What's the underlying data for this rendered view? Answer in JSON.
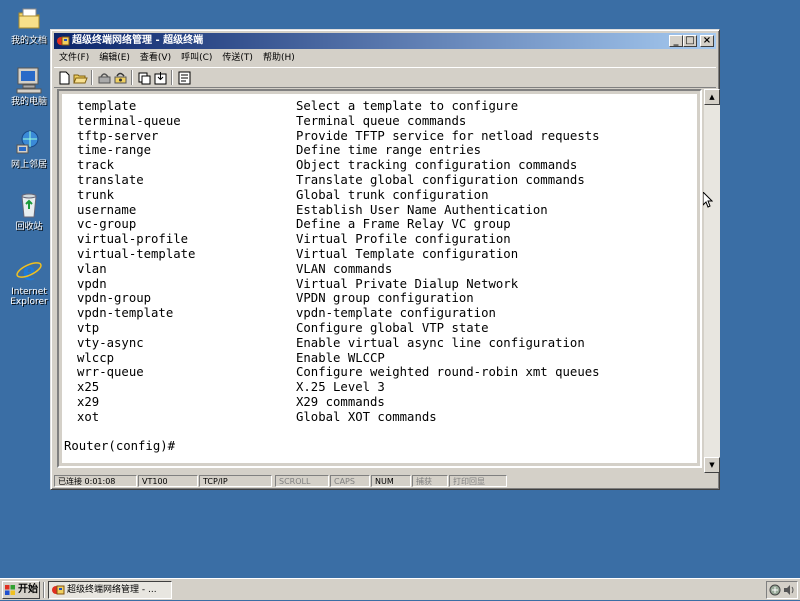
{
  "desktop": {
    "icons": [
      {
        "label": "我的文档",
        "icon": "my-documents-icon"
      },
      {
        "label": "我的电脑",
        "icon": "my-computer-icon"
      },
      {
        "label": "网上邻居",
        "icon": "network-places-icon"
      },
      {
        "label": "回收站",
        "icon": "recycle-bin-icon"
      },
      {
        "label": "Internet Explorer",
        "icon": "internet-explorer-icon"
      }
    ]
  },
  "window": {
    "title": "超级终端网络管理 - 超级终端",
    "controls": {
      "minimize": "_",
      "maximize": "□",
      "close": "×"
    },
    "menu": [
      "文件(F)",
      "编辑(E)",
      "查看(V)",
      "呼叫(C)",
      "传送(T)",
      "帮助(H)"
    ],
    "toolbar": [
      "new-icon",
      "open-icon",
      "connect-icon",
      "disconnect-icon",
      "send-icon",
      "receive-icon",
      "properties-icon"
    ]
  },
  "terminal": {
    "commands": [
      {
        "name": "template",
        "desc": "Select a template to configure"
      },
      {
        "name": "terminal-queue",
        "desc": "Terminal queue commands"
      },
      {
        "name": "tftp-server",
        "desc": "Provide TFTP service for netload requests"
      },
      {
        "name": "time-range",
        "desc": "Define time range entries"
      },
      {
        "name": "track",
        "desc": "Object tracking configuration commands"
      },
      {
        "name": "translate",
        "desc": "Translate global configuration commands"
      },
      {
        "name": "trunk",
        "desc": "Global trunk configuration"
      },
      {
        "name": "username",
        "desc": "Establish User Name Authentication"
      },
      {
        "name": "vc-group",
        "desc": "Define a Frame Relay VC group"
      },
      {
        "name": "virtual-profile",
        "desc": "Virtual Profile configuration"
      },
      {
        "name": "virtual-template",
        "desc": "Virtual Template configuration"
      },
      {
        "name": "vlan",
        "desc": "VLAN commands"
      },
      {
        "name": "vpdn",
        "desc": "Virtual Private Dialup Network"
      },
      {
        "name": "vpdn-group",
        "desc": "VPDN group configuration"
      },
      {
        "name": "vpdn-template",
        "desc": "vpdn-template configuration"
      },
      {
        "name": "vtp",
        "desc": "Configure global VTP state"
      },
      {
        "name": "vty-async",
        "desc": "Enable virtual async line configuration"
      },
      {
        "name": "wlccp",
        "desc": "Enable WLCCP"
      },
      {
        "name": "wrr-queue",
        "desc": "Configure weighted round-robin xmt queues"
      },
      {
        "name": "x25",
        "desc": "X.25 Level 3"
      },
      {
        "name": "x29",
        "desc": "X29 commands"
      },
      {
        "name": "xot",
        "desc": "Global XOT commands"
      }
    ],
    "prompt": "Router(config)#"
  },
  "statusbar": {
    "connection": "已连接 0:01:08",
    "emulation": "VT100",
    "protocol": "TCP/IP",
    "scroll": "SCROLL",
    "caps": "CAPS",
    "num": "NUM",
    "capture": "捕获",
    "print_echo": "打印回显"
  },
  "taskbar": {
    "start_label": "开始",
    "task_label": "超级终端网络管理 - ..."
  },
  "colors": {
    "desktop": "#3a6ea5",
    "title_start": "#0a246a",
    "title_end": "#a6caf0",
    "face": "#d4d0c8"
  }
}
